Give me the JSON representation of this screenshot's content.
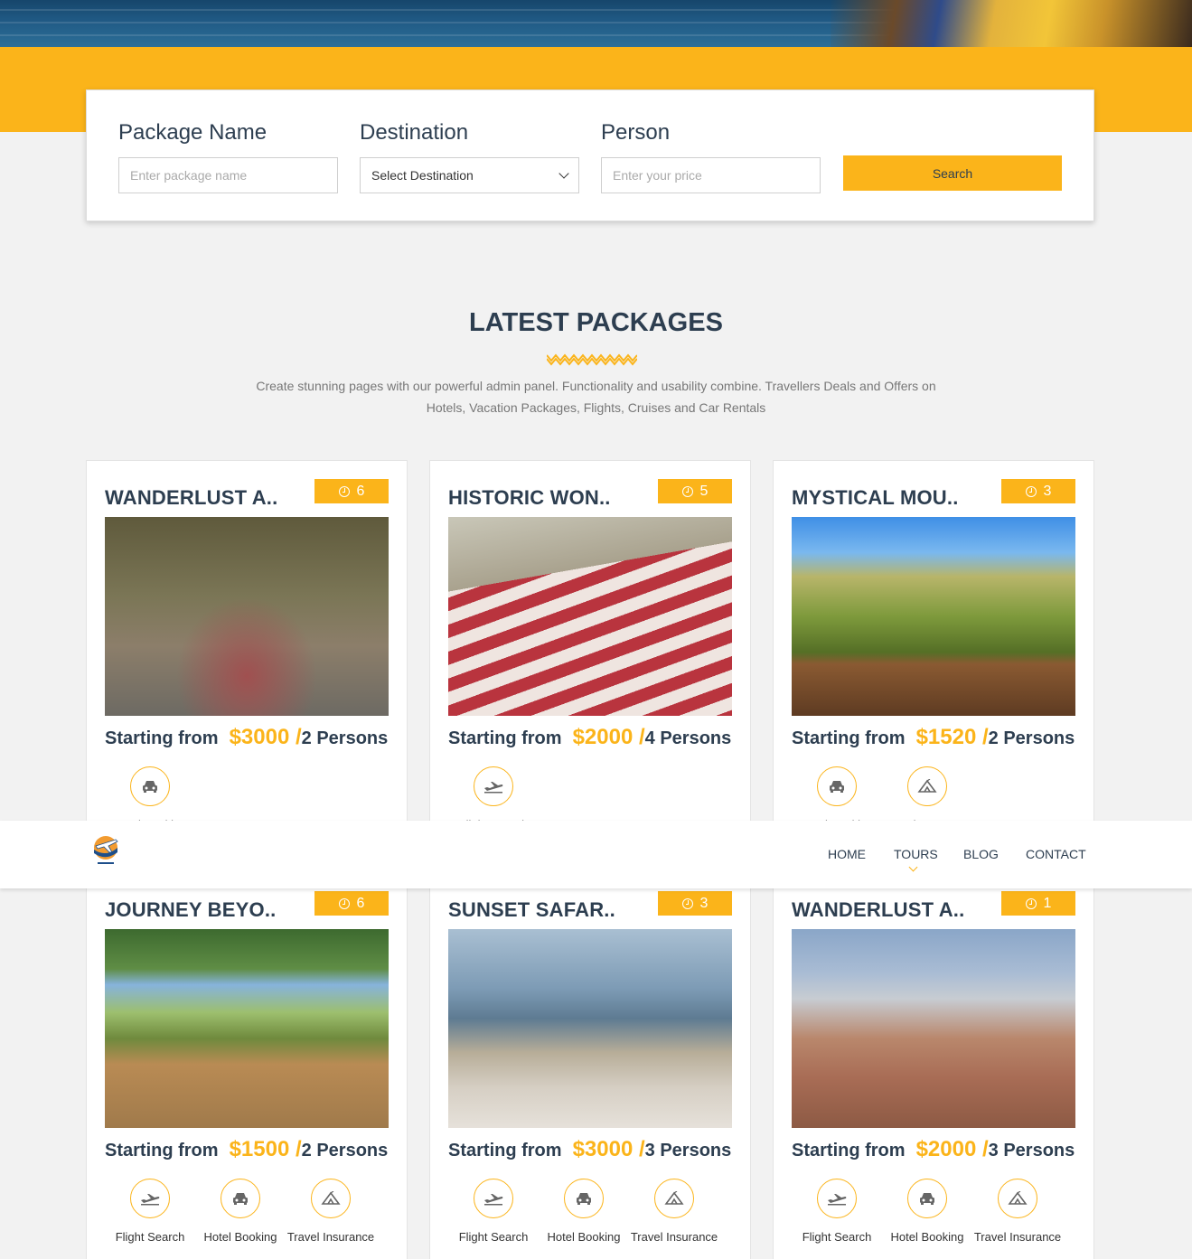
{
  "search": {
    "package_label": "Package Name",
    "package_placeholder": "Enter package name",
    "destination_label": "Destination",
    "destination_value": "Select Destination",
    "person_label": "Person",
    "person_placeholder": "Enter your price",
    "button_label": "Search"
  },
  "section": {
    "title": "LATEST PACKAGES",
    "description": "Create stunning pages with our powerful admin panel. Functionality and usability combine. Travellers Deals and Offers on Hotels, Vacation Packages, Flights, Cruises and Car Rentals"
  },
  "nav": {
    "home": "HOME",
    "tours": "TOURS",
    "blog": "BLOG",
    "contact": "CONTACT"
  },
  "colors": {
    "accent": "#fbb41a",
    "heading": "#2d3e50"
  },
  "packages": [
    {
      "title": "WANDERLUST A..",
      "days": "6",
      "starting": "Starting from",
      "price": "$3000 /",
      "persons": "2 Persons",
      "features": [
        {
          "label": "Hotel Booking",
          "icon": "car-icon"
        }
      ]
    },
    {
      "title": "HISTORIC WON..",
      "days": "5",
      "starting": "Starting from",
      "price": "$2000 /",
      "persons": "4 Persons",
      "features": [
        {
          "label": "Flight Search",
          "icon": "plane-icon"
        }
      ]
    },
    {
      "title": "MYSTICAL MOU..",
      "days": "3",
      "starting": "Starting from",
      "price": "$1520 /",
      "persons": "2 Persons",
      "features": [
        {
          "label": "Hotel Booking",
          "icon": "car-icon"
        },
        {
          "label": "Travel Insurance",
          "icon": "tent-icon"
        }
      ]
    },
    {
      "title": "JOURNEY BEYO..",
      "days": "6",
      "starting": "Starting from",
      "price": "$1500 /",
      "persons": "2 Persons",
      "features": [
        {
          "label": "Flight Search",
          "icon": "plane-icon"
        },
        {
          "label": "Hotel Booking",
          "icon": "car-icon"
        },
        {
          "label": "Travel Insurance",
          "icon": "tent-icon"
        }
      ]
    },
    {
      "title": "SUNSET SAFAR..",
      "days": "3",
      "starting": "Starting from",
      "price": "$3000 /",
      "persons": "3 Persons",
      "features": [
        {
          "label": "Flight Search",
          "icon": "plane-icon"
        },
        {
          "label": "Hotel Booking",
          "icon": "car-icon"
        },
        {
          "label": "Travel Insurance",
          "icon": "tent-icon"
        }
      ]
    },
    {
      "title": "WANDERLUST A..",
      "days": "1",
      "starting": "Starting from",
      "price": "$2000 /",
      "persons": "3 Persons",
      "features": [
        {
          "label": "Flight Search",
          "icon": "plane-icon"
        },
        {
          "label": "Hotel Booking",
          "icon": "car-icon"
        },
        {
          "label": "Travel Insurance",
          "icon": "tent-icon"
        }
      ]
    }
  ]
}
